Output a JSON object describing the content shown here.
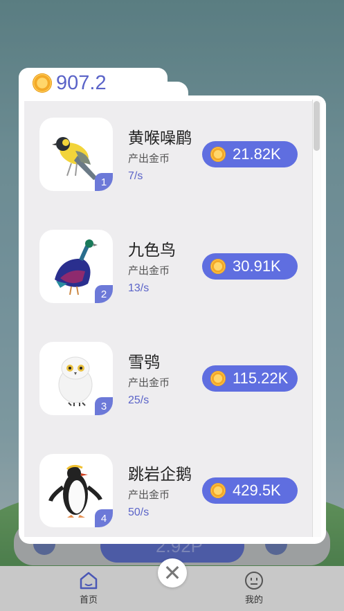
{
  "balance": "907.2",
  "birds": [
    {
      "name": "黄喉噪鹛",
      "sub": "产出金币",
      "rate": "7/s",
      "price": "21.82K",
      "level": "1",
      "icon": "yellow-throated-laughingthrush-icon"
    },
    {
      "name": "九色鸟",
      "sub": "产出金币",
      "rate": "13/s",
      "price": "30.91K",
      "level": "2",
      "icon": "monal-pheasant-icon"
    },
    {
      "name": "雪鸮",
      "sub": "产出金币",
      "rate": "25/s",
      "price": "115.22K",
      "level": "3",
      "icon": "snowy-owl-icon"
    },
    {
      "name": "跳岩企鹅",
      "sub": "产出金币",
      "rate": "50/s",
      "price": "429.5K",
      "level": "4",
      "icon": "rockhopper-penguin-icon"
    }
  ],
  "nav": {
    "home": "首页",
    "mine": "我的"
  },
  "background": {
    "ghost_value": "2.92P"
  },
  "colors": {
    "accent": "#5f6ee0",
    "text_accent": "#5a63c8"
  }
}
